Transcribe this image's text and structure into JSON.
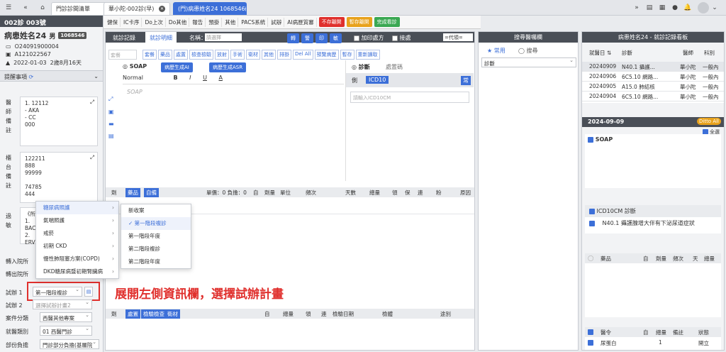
{
  "tabs": [
    {
      "label": "門診診間清單"
    },
    {
      "label": "華小陀-002診(早)"
    },
    {
      "label": "(門)病患姓名24 1068546"
    }
  ],
  "patient": {
    "header": "002診 003號",
    "name": "病患姓名24",
    "sex": "男",
    "id": "1068546",
    "line1": "O24091900004",
    "line2": "A121022567",
    "birth": "2022-01-03",
    "age": "2歲8月16天"
  },
  "reminders": {
    "title": "提醒事項"
  },
  "doctor_note": {
    "label": "醫師備註",
    "lines": [
      "1. 12112",
      "- AKA",
      "- CC",
      "000"
    ]
  },
  "counter_note": {
    "label": "櫃台備註",
    "lines": [
      "122211",
      "888",
      "99999",
      "",
      "74785",
      "444"
    ]
  },
  "allergy": {
    "label": "過敏",
    "lines": [
      "《所",
      "1.",
      "BACL",
      "2. ERV"
    ]
  },
  "fields": {
    "referral_in": "轉入院所",
    "referral_out": "轉出院所",
    "trial1_label": "試辦 1",
    "trial1_value": "第一階段複診",
    "trial2_label": "試辦 2",
    "trial2_placeholder": "選擇試辦計畫2",
    "case_label": "案件分類",
    "case_value": "西醫其他專案",
    "visit_label": "就醫類別",
    "visit_value": "01 西醫門診",
    "copay_label": "部份負擔",
    "copay_value": "門診部分負擔(基層院"
  },
  "menu_main": [
    {
      "label": "糖尿病照護",
      "hl": true
    },
    {
      "label": "氣喘照護",
      "hl": false
    },
    {
      "label": "戒菸",
      "hl": false
    },
    {
      "label": "初期 CKD",
      "hl": false
    },
    {
      "label": "慢性肺阻塞方案(COPD)",
      "hl": false
    },
    {
      "label": "DKD糖尿病暨初期腎臟病",
      "hl": false
    }
  ],
  "menu_sub": [
    {
      "label": "新收案",
      "hl": false
    },
    {
      "label": "第一階段複診",
      "hl": true
    },
    {
      "label": "第一階段年度",
      "hl": false
    },
    {
      "label": "第二階段複診",
      "hl": false
    },
    {
      "label": "第二階段年度",
      "hl": false
    }
  ],
  "annotation": "展開左側資訊欄，選擇試辦計畫",
  "toolbar": {
    "items": [
      "健保",
      "IC卡序",
      "Do上次",
      "Do其他",
      "報告",
      "預掛",
      "其他",
      "PACS系統",
      "試辦",
      "AI病歷質審"
    ],
    "btn_nosave": "不存離開",
    "btn_tempsave": "暫存離開",
    "btn_finish": "完成看診"
  },
  "main": {
    "tab_record": "就診記錄",
    "tab_detail": "就診明細",
    "name_label": "名稱：",
    "name_placeholder": "請選擇",
    "btn_turn": "轉",
    "btn_alert": "警",
    "btn_print": "印",
    "btn_sensitive": "敏",
    "add_rx": "加印處方",
    "urgent": "接處",
    "dept": "=代領=",
    "quick_buttons": [
      "套餐",
      "藥品",
      "處置",
      "檢查檢驗",
      "放射",
      "手術",
      "衛材",
      "其他",
      "排掛",
      "Del All",
      "預覽病歷",
      "暫存",
      "重新讀取"
    ],
    "quick_placeholder": "套餐",
    "soap_title": "SOAP",
    "ai_gen": "病歷生成AI",
    "ai_asr": "病歷生成ASR",
    "font_normal": "Normal",
    "soap_placeholder": "SOAP",
    "diag_title": "診斷",
    "diag_tab2": "處置碼",
    "icd_side": "側",
    "icd_label": "ICD10",
    "icd_button": "常",
    "icd_placeholder": "請輸入ICD10CM",
    "med_cols": [
      "劑",
      "藥品",
      "自備",
      "單價：0 負擔：0",
      "自",
      "劑量",
      "單位",
      "頻次",
      "天數",
      "總量",
      "領",
      "保",
      "連",
      "粉",
      "原因"
    ],
    "med_search": "",
    "order_cols": [
      "劑",
      "處置",
      "檢驗檢查",
      "衛材",
      "自",
      "總量",
      "領",
      "連",
      "檢驗日期",
      "檢體",
      "途別"
    ]
  },
  "middle": {
    "title": "搜尋醫囑欄",
    "tab_common": "常用",
    "tab_search": "搜尋",
    "dropdown": "診斷"
  },
  "right": {
    "title": "病患姓名24 - 就診記錄看板",
    "cols": [
      "就醫日",
      "診斷",
      "醫師",
      "科別"
    ],
    "rows": [
      {
        "date": "20240909",
        "diag": "N40.1 攝護...",
        "doctor": "華小陀",
        "dept": "一般內"
      },
      {
        "date": "20240906",
        "diag": "6C5.10 網路...",
        "doctor": "華小陀",
        "dept": "一般內"
      },
      {
        "date": "20240905",
        "diag": "A15.0 肺結核",
        "doctor": "華小陀",
        "dept": "一般內"
      },
      {
        "date": "20240904",
        "diag": "6C5.10 網路...",
        "doctor": "華小陀",
        "dept": "一般內"
      }
    ],
    "detail_date": "2024-09-09",
    "ditto_all": "Ditto All",
    "select_all": "全選",
    "soap": "SOAP",
    "icd_title": "ICD10CM 診斷",
    "icd_item": "N40.1 攝護腺增大伴有下泌尿道症狀",
    "med_cols": [
      "藥品",
      "自",
      "劑量",
      "頻次",
      "天",
      "總量"
    ],
    "order_cols": [
      "醫令",
      "自",
      "總量",
      "備註",
      "狀態"
    ],
    "order_row": {
      "name": "尿蛋白",
      "qty": "1",
      "status": "開立"
    }
  },
  "colors": {
    "accent": "#3c6fd8",
    "dark": "#4a4f57",
    "red": "#e0302d",
    "orange": "#e8a21c",
    "green": "#3aa852"
  }
}
